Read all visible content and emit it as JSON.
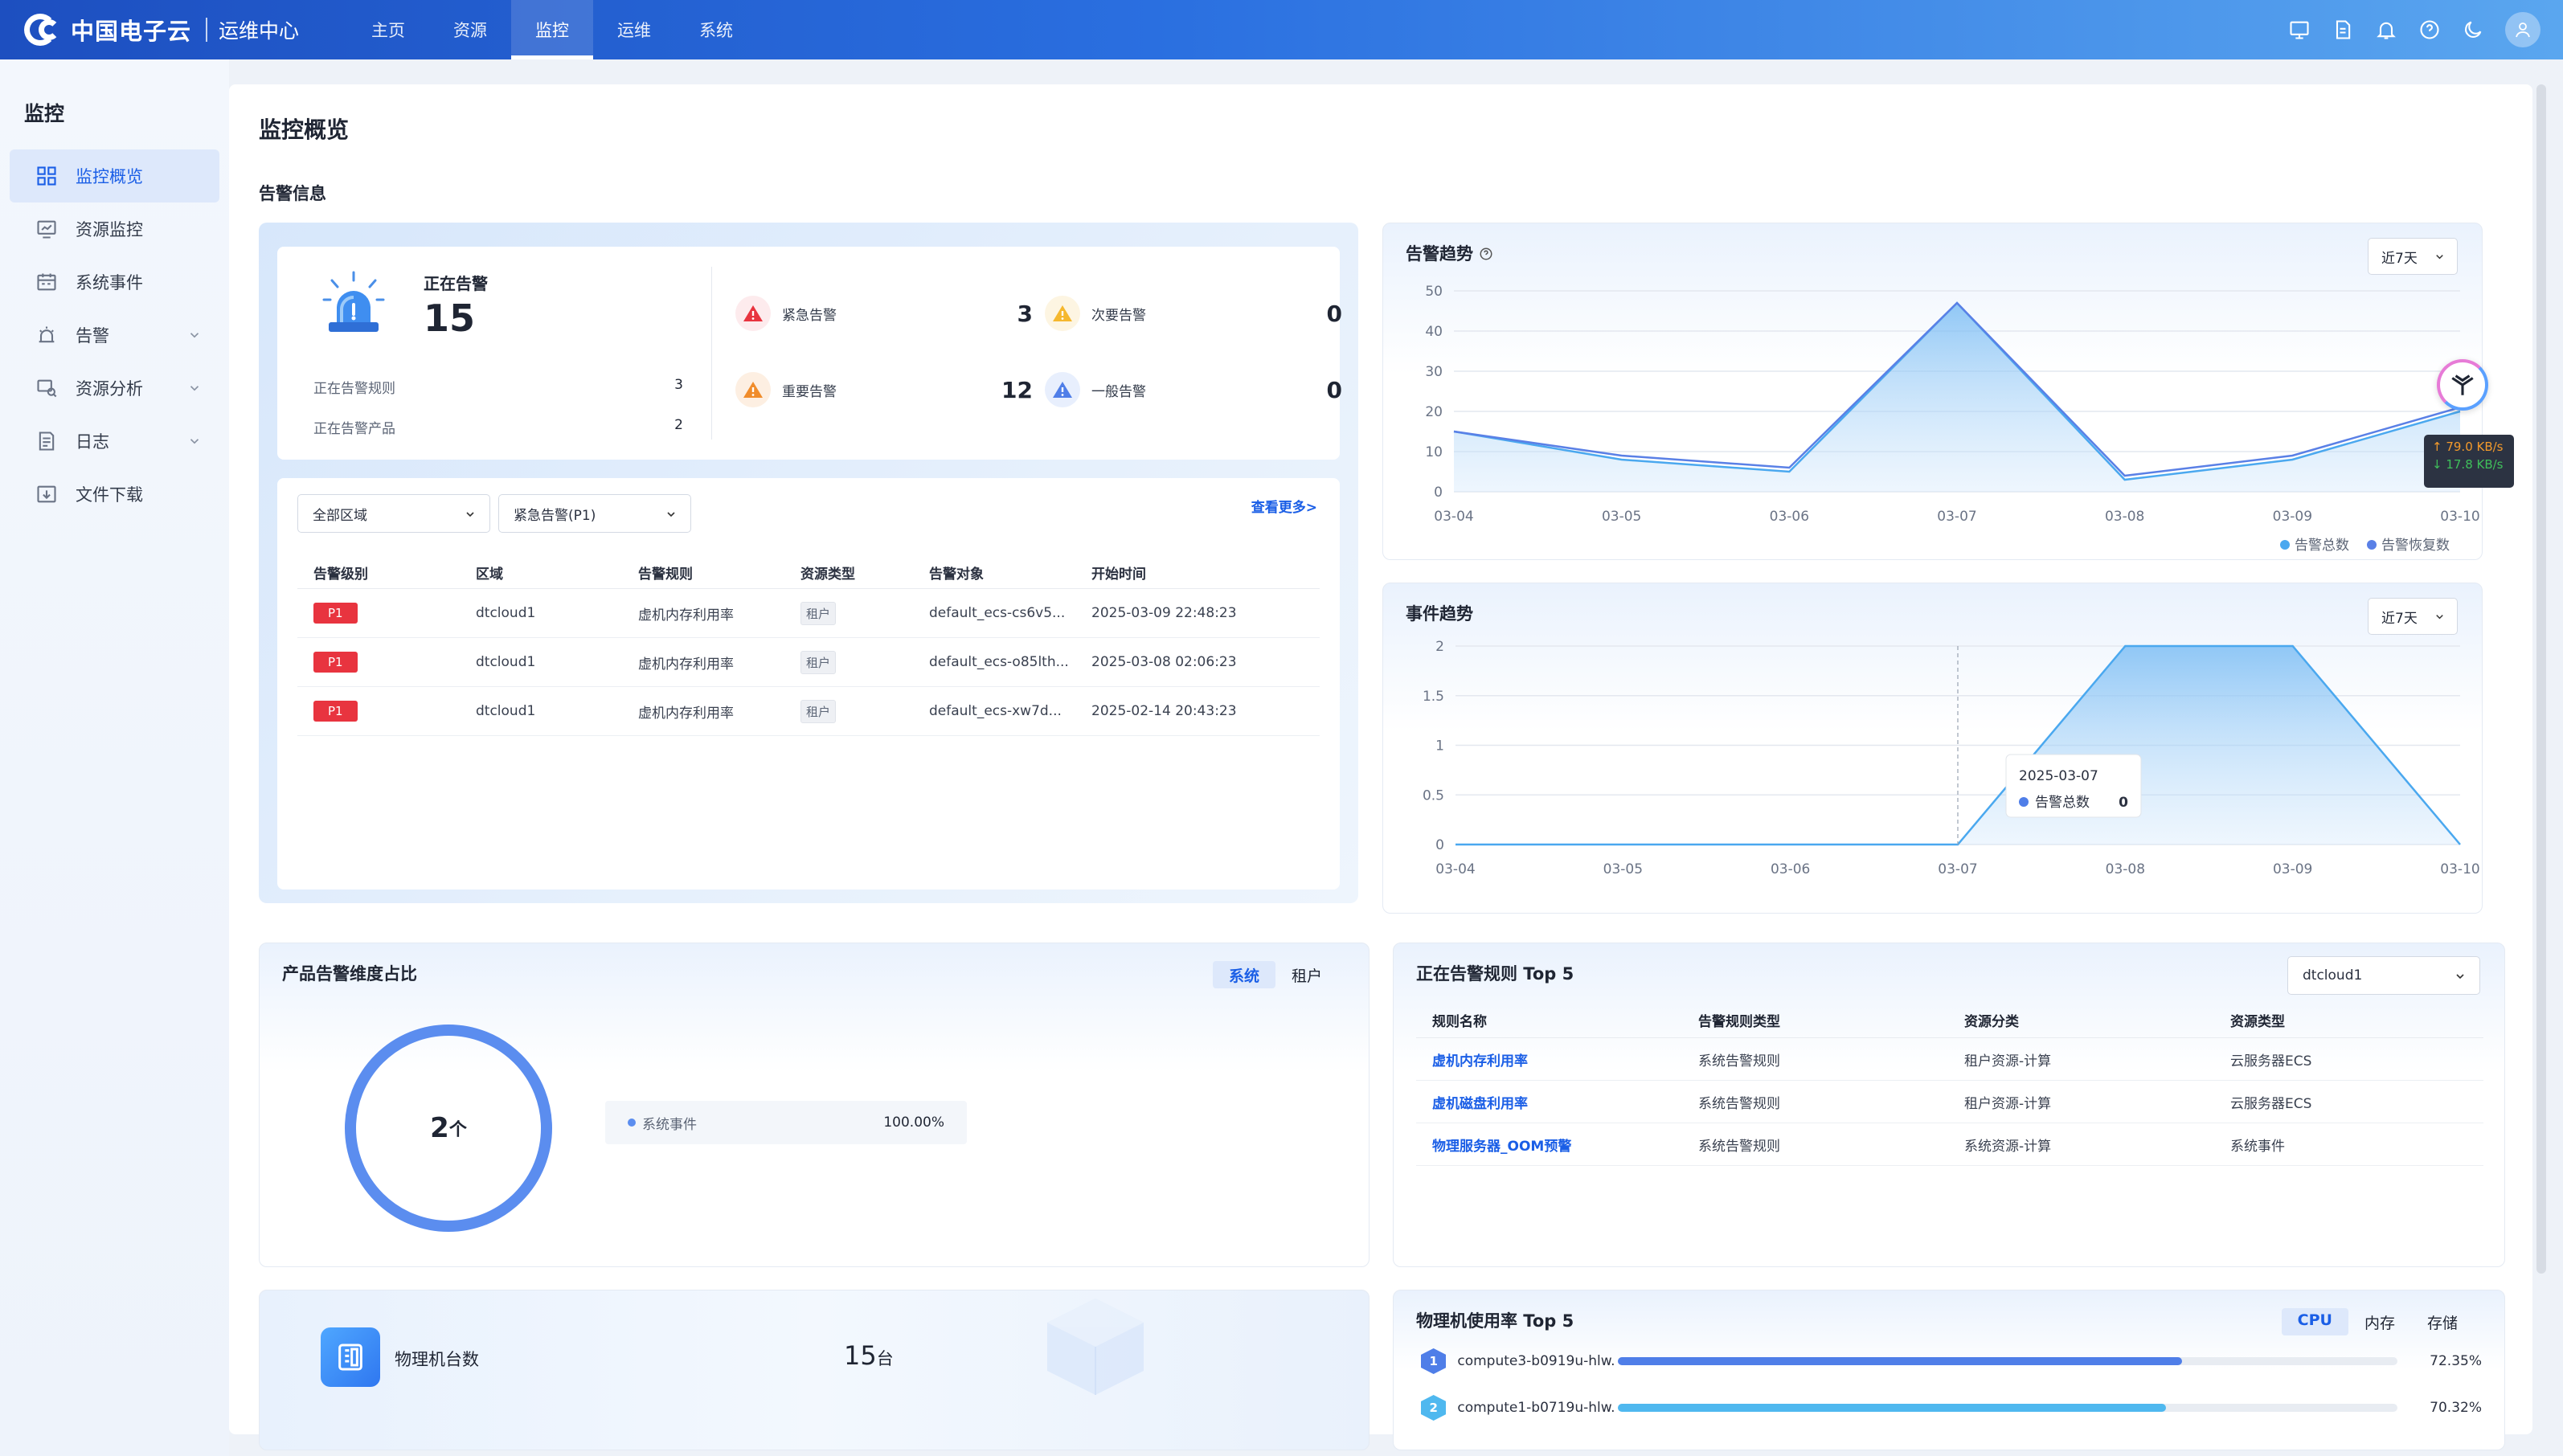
{
  "header": {
    "logo_text": "中国电子云",
    "app_name": "运维中心",
    "nav": [
      {
        "label": "主页"
      },
      {
        "label": "资源"
      },
      {
        "label": "监控"
      },
      {
        "label": "运维"
      },
      {
        "label": "系统"
      }
    ],
    "active_nav": "监控",
    "icons": [
      "screen-icon",
      "document-icon",
      "bell-icon",
      "help-icon",
      "moon-icon",
      "user-icon"
    ]
  },
  "sidebar": {
    "title": "监控",
    "items": [
      {
        "label": "监控概览",
        "icon": "dashboard-icon",
        "active": true
      },
      {
        "label": "资源监控",
        "icon": "monitor-icon"
      },
      {
        "label": "系统事件",
        "icon": "calendar-icon"
      },
      {
        "label": "告警",
        "icon": "alarm-icon",
        "expandable": true
      },
      {
        "label": "资源分析",
        "icon": "analysis-icon",
        "expandable": true
      },
      {
        "label": "日志",
        "icon": "log-icon",
        "expandable": true
      },
      {
        "label": "文件下载",
        "icon": "download-icon"
      }
    ]
  },
  "page": {
    "title": "监控概览",
    "section_alert": "告警信息"
  },
  "alert_summary": {
    "label": "正在告警",
    "value": "15",
    "rules_label": "正在告警规则",
    "rules_value": "3",
    "products_label": "正在告警产品",
    "products_value": "2",
    "levels": [
      {
        "name": "紧急告警",
        "value": "3",
        "color": "#e8343f"
      },
      {
        "name": "次要告警",
        "value": "0",
        "color": "#f5b82e"
      },
      {
        "name": "重要告警",
        "value": "12",
        "color": "#f08c2b"
      },
      {
        "name": "一般告警",
        "value": "0",
        "color": "#4f7ee8"
      }
    ]
  },
  "alert_table": {
    "region_select": "全部区域",
    "level_select": "紧急告警(P1)",
    "more": "查看更多>",
    "columns": [
      "告警级别",
      "区域",
      "告警规则",
      "资源类型",
      "告警对象",
      "开始时间"
    ],
    "rows": [
      {
        "level": "P1",
        "region": "dtcloud1",
        "rule": "虚机内存利用率",
        "type": "租户",
        "object": "default_ecs-cs6v5...",
        "time": "2025-03-09 22:48:23"
      },
      {
        "level": "P1",
        "region": "dtcloud1",
        "rule": "虚机内存利用率",
        "type": "租户",
        "object": "default_ecs-o85lth...",
        "time": "2025-03-08 02:06:23"
      },
      {
        "level": "P1",
        "region": "dtcloud1",
        "rule": "虚机内存利用率",
        "type": "租户",
        "object": "default_ecs-xw7d...",
        "time": "2025-02-14 20:43:23"
      }
    ]
  },
  "chart_data": [
    {
      "type": "area",
      "title": "告警趋势",
      "range_label": "近7天",
      "categories": [
        "03-04",
        "03-05",
        "03-06",
        "03-07",
        "03-08",
        "03-09",
        "03-10"
      ],
      "ylim": [
        0,
        50
      ],
      "yticks": [
        "0",
        "10",
        "20",
        "30",
        "40",
        "50"
      ],
      "series": [
        {
          "name": "告警总数",
          "values": [
            15,
            8,
            5,
            47,
            3,
            8,
            20
          ],
          "color": "#4aa8ef"
        },
        {
          "name": "告警恢复数",
          "values": [
            15,
            9,
            6,
            47,
            4,
            9,
            21
          ],
          "color": "#5a80e6"
        }
      ],
      "legend": "bottom-right",
      "grid": true
    },
    {
      "type": "area",
      "title": "事件趋势",
      "range_label": "近7天",
      "categories": [
        "03-04",
        "03-05",
        "03-06",
        "03-07",
        "03-08",
        "03-09",
        "03-10"
      ],
      "ylim": [
        0,
        2
      ],
      "yticks": [
        "0",
        "0.5",
        "1",
        "1.5",
        "2"
      ],
      "series": [
        {
          "name": "告警总数",
          "values": [
            0,
            0,
            0,
            0,
            2,
            2,
            0
          ],
          "color": "#4aa8ef"
        }
      ],
      "tooltip": {
        "date": "2025-03-07",
        "series": "告警总数",
        "value": "0"
      },
      "grid": true
    }
  ],
  "product_dimension": {
    "title": "产品告警维度占比",
    "tabs": [
      "系统",
      "租户"
    ],
    "active_tab": "系统",
    "center_value": "2",
    "center_unit": "个",
    "legend_name": "系统事件",
    "legend_value": "100.00%",
    "ring_color": "#5b8def"
  },
  "rules_top5": {
    "title": "正在告警规则 Top 5",
    "region_select": "dtcloud1",
    "columns": [
      "规则名称",
      "告警规则类型",
      "资源分类",
      "资源类型"
    ],
    "rows": [
      {
        "name": "虚机内存利用率",
        "rule_type": "系统告警规则",
        "category": "租户资源-计算",
        "resource": "云服务器ECS"
      },
      {
        "name": "虚机磁盘利用率",
        "rule_type": "系统告警规则",
        "category": "租户资源-计算",
        "resource": "云服务器ECS"
      },
      {
        "name": "物理服务器_OOM预警",
        "rule_type": "系统告警规则",
        "category": "系统资源-计算",
        "resource": "系统事件"
      }
    ]
  },
  "physical": {
    "label": "物理机台数",
    "value": "15",
    "unit": "台"
  },
  "usage_top5": {
    "title": "物理机使用率 Top 5",
    "tabs": [
      "CPU",
      "内存",
      "存储"
    ],
    "active_tab": "CPU",
    "rows": [
      {
        "rank": "1",
        "name": "compute3-b0919u-hlw...",
        "value": "72.35%",
        "fraction": 0.7235,
        "color": "#4f7ee8"
      },
      {
        "rank": "2",
        "name": "compute1-b0719u-hlw...",
        "value": "70.32%",
        "fraction": 0.7032,
        "color": "#4fb8ef"
      }
    ]
  },
  "network": {
    "up": "↑ 79.0 KB/s",
    "down": "↓ 17.8 KB/s"
  }
}
